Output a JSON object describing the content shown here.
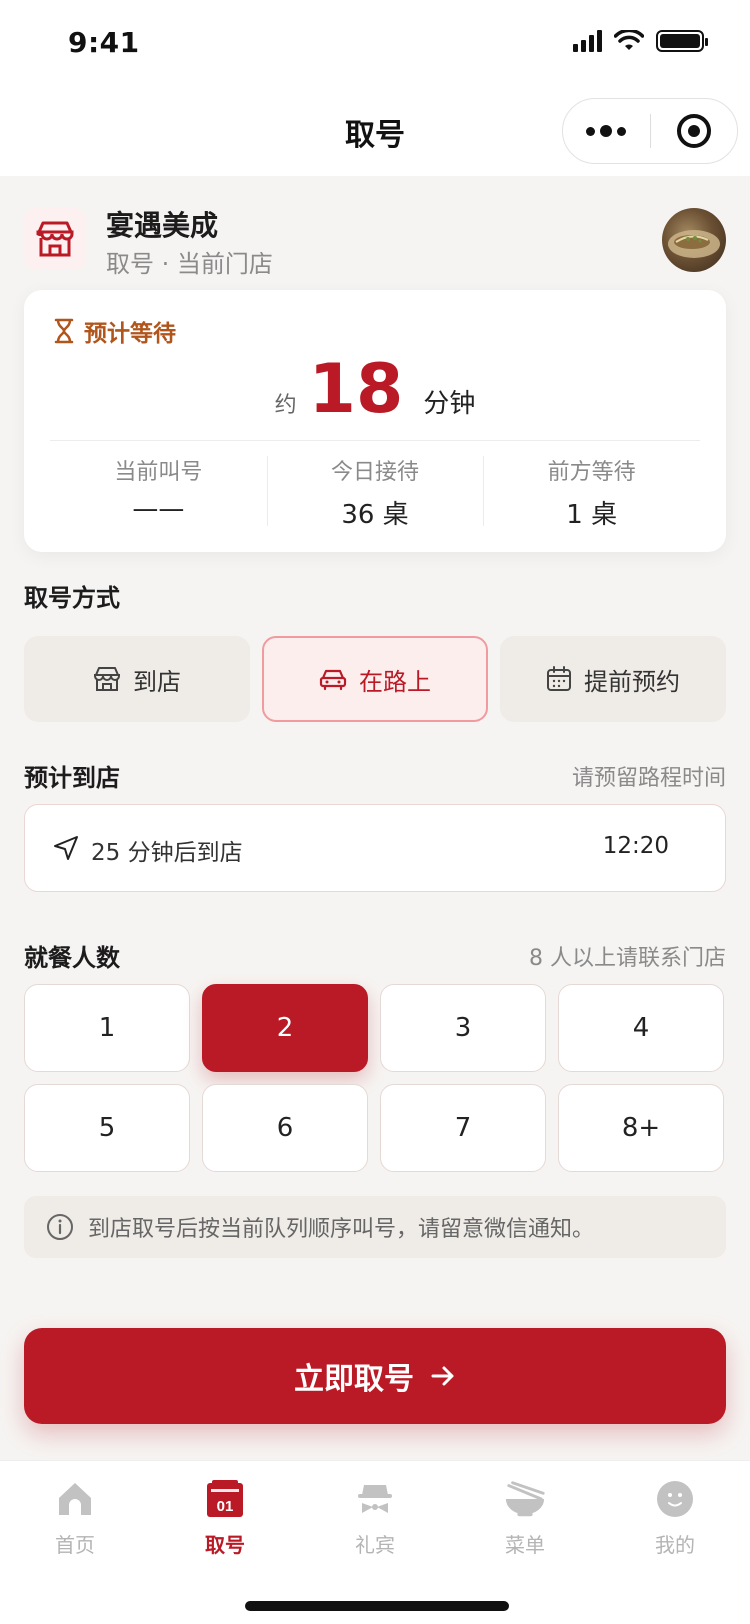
{
  "status_bar": {
    "time": "9:41"
  },
  "nav": {
    "title": "取号"
  },
  "store": {
    "name": "宴遇美成",
    "subtitle": "取号 · 当前门店"
  },
  "wait": {
    "label": "预计等待",
    "prefix": "约",
    "minutes": "18",
    "unit": "分钟",
    "stats": [
      {
        "label": "当前叫号",
        "value": "——"
      },
      {
        "label": "今日接待",
        "value": "36 桌"
      },
      {
        "label": "前方等待",
        "value": "1 桌"
      }
    ]
  },
  "mode_section": {
    "title": "取号方式",
    "options": [
      {
        "label": "到店",
        "icon": "store-icon"
      },
      {
        "label": "在路上",
        "icon": "car-icon",
        "selected": true
      },
      {
        "label": "提前预约",
        "icon": "calendar-icon"
      }
    ]
  },
  "arrival_section": {
    "title": "预计到店",
    "hint": "请预留路程时间",
    "value": "25 分钟后到店",
    "time": "12:20"
  },
  "party_section": {
    "title": "就餐人数",
    "hint": "8 人以上请联系门店",
    "sizes": [
      "1",
      "2",
      "3",
      "4",
      "5",
      "6",
      "7",
      "8+"
    ],
    "selected": "2"
  },
  "notice": {
    "text": "到店取号后按当前队列顺序叫号，请留意微信通知。"
  },
  "primary_button": {
    "label": "立即取号"
  },
  "tabbar": {
    "items": [
      {
        "label": "首页",
        "icon": "home-icon"
      },
      {
        "label": "取号",
        "icon": "ticket-icon",
        "active": true,
        "badge": "01"
      },
      {
        "label": "礼宾",
        "icon": "concierge-icon"
      },
      {
        "label": "菜单",
        "icon": "bowl-icon"
      },
      {
        "label": "我的",
        "icon": "profile-icon"
      }
    ]
  },
  "colors": {
    "brand": "#b91a26",
    "accent_orange": "#b0561c",
    "background": "#f6f4f2"
  }
}
